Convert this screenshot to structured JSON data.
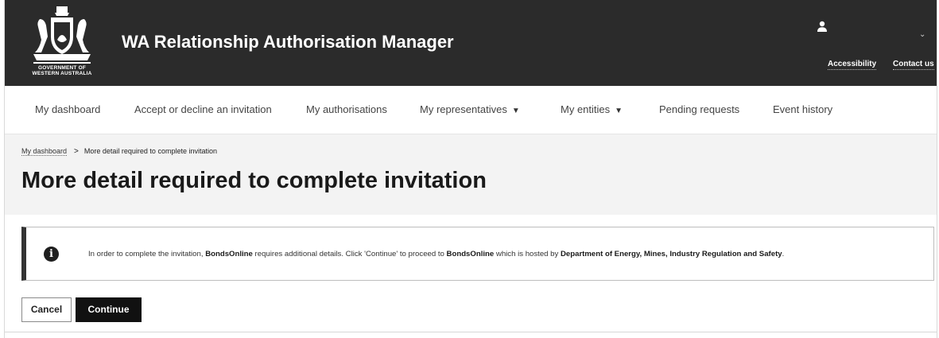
{
  "header": {
    "logo_line1": "GOVERNMENT OF",
    "logo_line2": "WESTERN AUSTRALIA",
    "app_title": "WA Relationship Authorisation Manager",
    "links": {
      "accessibility": "Accessibility",
      "contact": "Contact us"
    },
    "icons": {
      "user": "user-icon",
      "menu": "chevron-down-icon"
    }
  },
  "nav": {
    "items": [
      {
        "label": "My dashboard"
      },
      {
        "label": "Accept or decline an invitation"
      },
      {
        "label": "My authorisations"
      },
      {
        "label": "My representatives",
        "dropdown": true
      },
      {
        "label": "My entities",
        "dropdown": true
      },
      {
        "label": "Pending requests"
      },
      {
        "label": "Event history"
      }
    ]
  },
  "breadcrumb": {
    "parent": "My dashboard",
    "separator": ">",
    "current": "More detail required to complete invitation"
  },
  "page_title": "More detail required to complete invitation",
  "callout": {
    "icon": "info-icon",
    "t1": "In order to complete the invitation, ",
    "b1": "BondsOnline",
    "t2": " requires additional details. Click 'Continue' to proceed to ",
    "b2": "BondsOnline",
    "t3": " which is hosted by ",
    "b3": "Department of Energy, Mines, Industry Regulation and Safety",
    "t4": "."
  },
  "actions": {
    "cancel": "Cancel",
    "continue": "Continue"
  },
  "colors": {
    "header_bg": "#2b2b2b",
    "band_bg": "#f3f3f3",
    "primary_button": "#111111"
  }
}
